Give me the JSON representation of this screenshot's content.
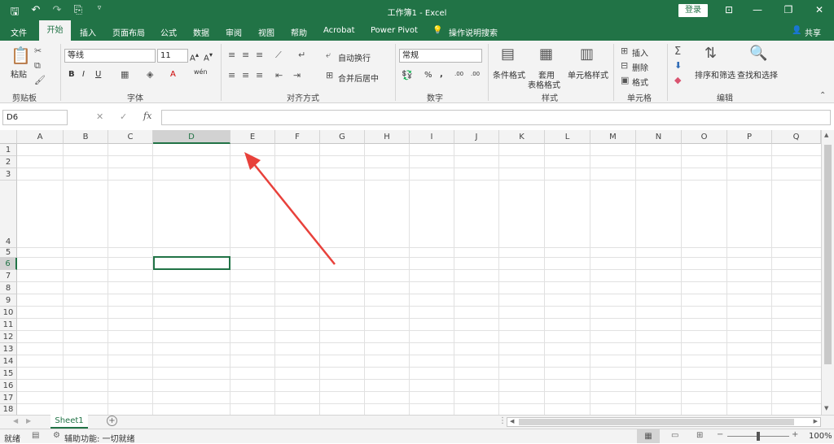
{
  "titlebar": {
    "save_icon": "save-icon",
    "title": "工作簿1 - Excel",
    "login": "登录"
  },
  "tabs": [
    {
      "label": "文件"
    },
    {
      "label": "开始"
    },
    {
      "label": "插入"
    },
    {
      "label": "页面布局"
    },
    {
      "label": "公式"
    },
    {
      "label": "数据"
    },
    {
      "label": "审阅"
    },
    {
      "label": "视图"
    },
    {
      "label": "帮助"
    },
    {
      "label": "Acrobat"
    },
    {
      "label": "Power Pivot"
    },
    {
      "label": "操作说明搜索"
    }
  ],
  "share": "共享",
  "ribbon": {
    "clipboard": {
      "paste": "粘贴",
      "label": "剪贴板"
    },
    "font": {
      "name": "等线",
      "size": "11",
      "label": "字体",
      "bold": "B",
      "italic": "I",
      "underline": "U",
      "font_color": "A",
      "phonetic": "wén"
    },
    "alignment": {
      "wrap": "自动换行",
      "merge": "合并后居中",
      "label": "对齐方式"
    },
    "number": {
      "format": "常规",
      "percent": "%",
      "comma": ",",
      "inc_decimal": ".00",
      "dec_decimal": ".00",
      "label": "数字"
    },
    "styles": {
      "cond_format": "条件格式",
      "table_format_1": "套用",
      "table_format_2": "表格格式",
      "cell_style": "单元格样式",
      "label": "样式"
    },
    "cells": {
      "insert": "插入",
      "delete": "删除",
      "format": "格式",
      "label": "单元格"
    },
    "editing": {
      "sort": "排序和筛选",
      "find": "查找和选择",
      "label": "编辑"
    }
  },
  "formula_bar": {
    "name_box": "D6",
    "fx": "fx",
    "value": ""
  },
  "columns": [
    "A",
    "B",
    "C",
    "D",
    "E",
    "F",
    "G",
    "H",
    "I",
    "J",
    "K",
    "L",
    "M",
    "N",
    "O",
    "P",
    "Q"
  ],
  "rows": [
    "1",
    "2",
    "3",
    "4",
    "5",
    "6",
    "7",
    "8",
    "9",
    "10",
    "11",
    "12",
    "13",
    "14",
    "15",
    "16",
    "17",
    "18"
  ],
  "sheet": {
    "name": "Sheet1",
    "add": "+"
  },
  "status": {
    "ready": "就绪",
    "accessibility": "辅助功能: 一切就绪",
    "zoom": "100%"
  },
  "colors": {
    "accent": "#217346",
    "arrow": "#e8413b"
  }
}
